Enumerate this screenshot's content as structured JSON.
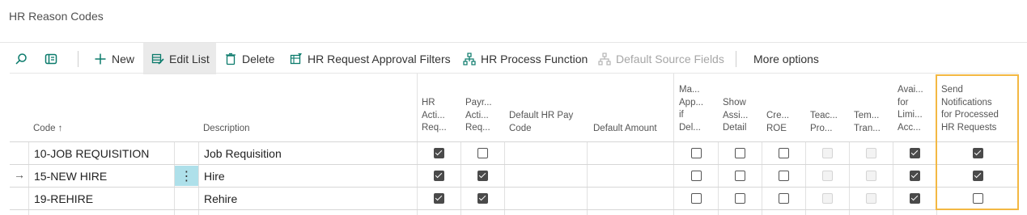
{
  "page": {
    "title": "HR Reason Codes"
  },
  "toolbar": {
    "new_label": "New",
    "edit_list_label": "Edit List",
    "delete_label": "Delete",
    "approval_filters_label": "HR Request Approval Filters",
    "process_function_label": "HR Process Function",
    "default_source_label": "Default Source Fields",
    "more_options_label": "More options"
  },
  "columns": {
    "code": "Code ↑",
    "description": "Description",
    "hr_action": [
      "HR",
      "Acti...",
      "Req..."
    ],
    "payroll_action": [
      "Payr...",
      "Acti...",
      "Req..."
    ],
    "default_pay_code": [
      "Default HR Pay",
      "Code"
    ],
    "default_amount": "Default Amount",
    "mandatory": [
      "Ma...",
      "App...",
      "if",
      "Del..."
    ],
    "show_assignment": [
      "Show",
      "Assi...",
      "Detail"
    ],
    "create_roe": [
      "Cre...",
      "ROE"
    ],
    "teacher": [
      "Teac...",
      "Pro..."
    ],
    "temp": [
      "Tem...",
      "Tran..."
    ],
    "available": [
      "Avai...",
      "for",
      "Limi...",
      "Acc..."
    ],
    "send_notifications": [
      "Send",
      "Notifications",
      "for Processed",
      "HR Requests"
    ]
  },
  "rows": [
    {
      "code": "10-JOB REQUISITION",
      "description": "Job Requisition"
    },
    {
      "code": "15-NEW HIRE",
      "description": "Hire"
    },
    {
      "code": "19-REHIRE",
      "description": "Rehire"
    }
  ],
  "checkbox_values": [
    {
      "hr_action": true,
      "payroll_action": false,
      "mandatory": false,
      "show_assignment": false,
      "create_roe": false,
      "teacher": false,
      "temp": false,
      "available": true,
      "send_notifications": true
    },
    {
      "hr_action": true,
      "payroll_action": true,
      "mandatory": false,
      "show_assignment": false,
      "create_roe": false,
      "teacher": false,
      "temp": false,
      "available": true,
      "send_notifications": true
    },
    {
      "hr_action": true,
      "payroll_action": true,
      "mandatory": false,
      "show_assignment": false,
      "create_roe": false,
      "teacher": false,
      "temp": false,
      "available": true,
      "send_notifications": false
    }
  ],
  "colors": {
    "accent": "#0a7a6b",
    "highlight_border": "#f3b843",
    "row_menu_bg": "#aee0ea"
  },
  "icons": [
    "search-icon",
    "filter-pane-icon",
    "plus-icon",
    "edit-list-icon",
    "delete-icon",
    "approval-filters-icon",
    "process-function-icon",
    "default-source-icon",
    "row-menu-icon",
    "current-row-arrow-icon"
  ]
}
